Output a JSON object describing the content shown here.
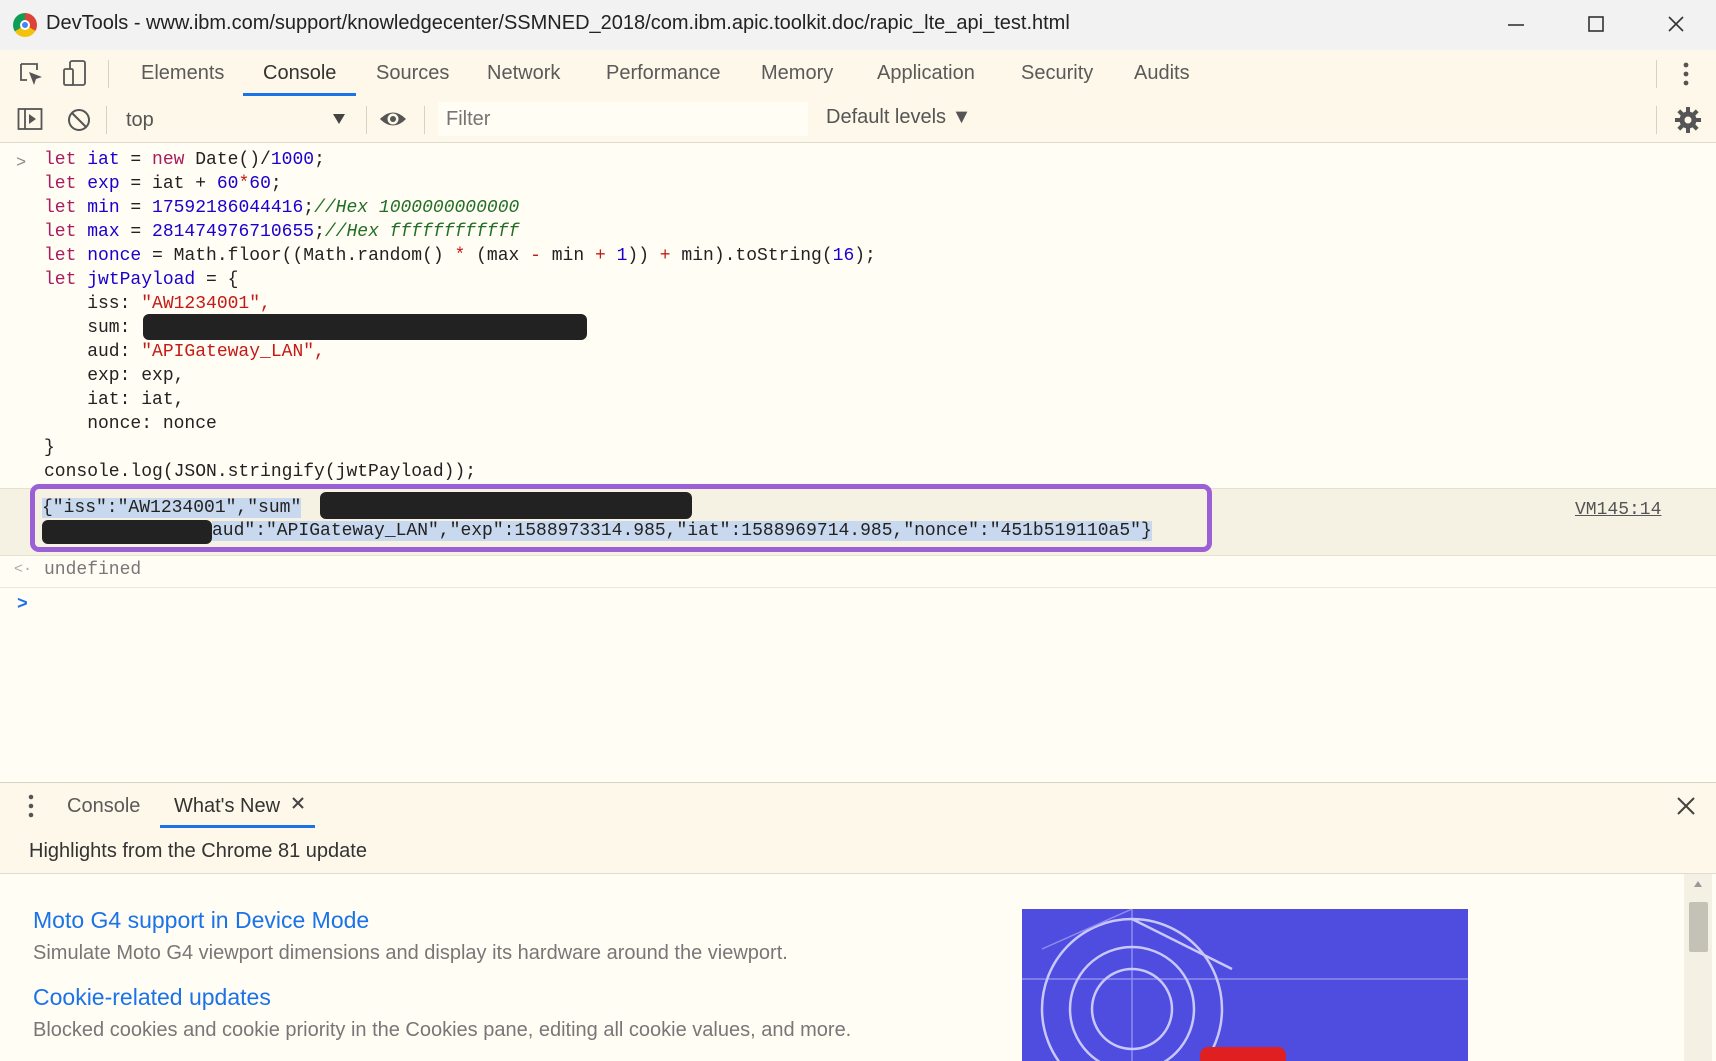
{
  "window": {
    "title": "DevTools - www.ibm.com/support/knowledgecenter/SSMNED_2018/com.ibm.apic.toolkit.doc/rapic_lte_api_test.html",
    "min_icon": "minimize-icon",
    "max_icon": "maximize-icon",
    "close_icon": "close-icon"
  },
  "tabs": [
    {
      "label": "Elements"
    },
    {
      "label": "Console",
      "active": true
    },
    {
      "label": "Sources"
    },
    {
      "label": "Network"
    },
    {
      "label": "Performance"
    },
    {
      "label": "Memory"
    },
    {
      "label": "Application"
    },
    {
      "label": "Security"
    },
    {
      "label": "Audits"
    }
  ],
  "toolbar": {
    "context": "top",
    "filter_placeholder": "Filter",
    "levels_label": "Default levels ▼"
  },
  "console": {
    "prompt_glyph": ">",
    "code_lines": {
      "l1": [
        "let ",
        "iat",
        " = ",
        "new ",
        "Date()/",
        "1000",
        ";"
      ],
      "l2": [
        "let ",
        "exp",
        " = ",
        "iat + ",
        "60",
        "*",
        "60",
        ";"
      ],
      "l3": [
        "let ",
        "min",
        " = ",
        "17592186044416",
        ";",
        "//Hex 1000000000000"
      ],
      "l4": [
        "let ",
        "max",
        " = ",
        "281474976710655",
        ";",
        "//Hex ffffffffffff"
      ],
      "l5": [
        "let ",
        "nonce",
        " = Math.floor((Math.random() ",
        "*",
        " (max ",
        "-",
        " min ",
        "+",
        " ",
        "1",
        ")) ",
        "+",
        " min).toString(",
        "16",
        ");"
      ],
      "l6": [
        "let ",
        "jwtPayload",
        " = {"
      ],
      "l7": [
        "    iss: ",
        "\"AW1234001\","
      ],
      "l8": [
        "    sum: "
      ],
      "l9": [
        "    aud: ",
        "\"APIGateway_LAN\","
      ],
      "l10": [
        "    exp: exp,"
      ],
      "l11": [
        "    iat: iat,"
      ],
      "l12": [
        "    nonce: nonce"
      ],
      "l13": [
        "}"
      ],
      "l14": [
        "console.log(JSON.stringify(jwtPayload));"
      ]
    },
    "log_line1": "{\"iss\":\"AW1234001\",\"sum\"",
    "log_line2": "aud\":\"APIGateway_LAN\",\"exp\":1588973314.985,\"iat\":1588969714.985,\"nonce\":\"451b519110a5\"}",
    "log_source": "VM145:14",
    "result_glyph": "<·",
    "result_value": "undefined",
    "input_prompt": ">"
  },
  "drawer": {
    "tabs": [
      {
        "label": "Console"
      },
      {
        "label": "What's New",
        "active": true
      }
    ],
    "header": "Highlights from the Chrome 81 update",
    "items": [
      {
        "title": "Moto G4 support in Device Mode",
        "desc": "Simulate Moto G4 viewport dimensions and display its hardware around the viewport."
      },
      {
        "title": "Cookie-related updates",
        "desc": "Blocked cookies and cookie priority in the Cookies pane, editing all cookie values, and more."
      }
    ]
  },
  "colors": {
    "accent": "#1a73e8",
    "highlight_border": "#9b5fd6",
    "promo_background": "#4f4ce0"
  }
}
